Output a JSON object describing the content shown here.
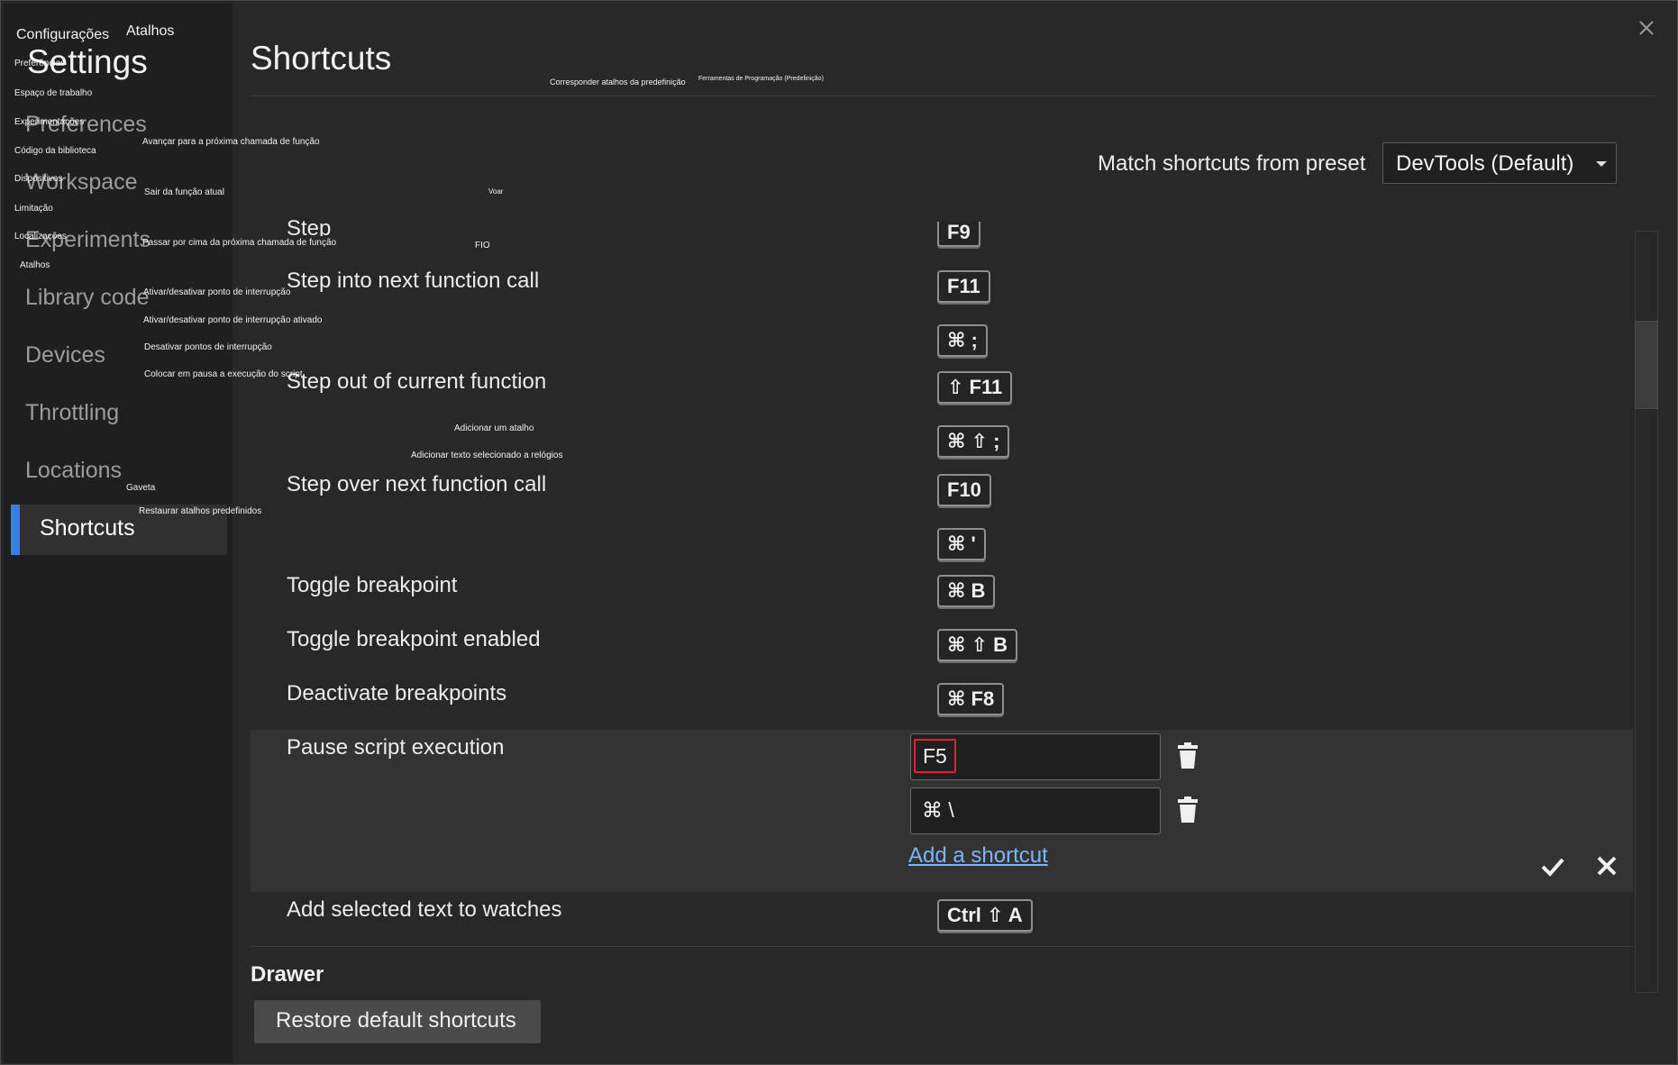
{
  "window": {
    "close_icon": "close-icon"
  },
  "sidebar": {
    "title": "Settings",
    "items": [
      {
        "id": "preferences",
        "label": "Preferences"
      },
      {
        "id": "workspace",
        "label": "Workspace"
      },
      {
        "id": "experiments",
        "label": "Experiments"
      },
      {
        "id": "library-code",
        "label": "Library code"
      },
      {
        "id": "devices",
        "label": "Devices"
      },
      {
        "id": "throttling",
        "label": "Throttling"
      },
      {
        "id": "locations",
        "label": "Locations"
      },
      {
        "id": "shortcuts",
        "label": "Shortcuts",
        "active": true
      }
    ],
    "accent_color": "#3a7ee0"
  },
  "main": {
    "title": "Shortcuts",
    "preset": {
      "label": "Match shortcuts from preset",
      "selected": "DevTools (Default)"
    },
    "shortcuts": [
      {
        "label": "Step",
        "keys": [
          "F9"
        ]
      },
      {
        "label": "Step into next function call",
        "keys": [
          "F11",
          "⌘ ;"
        ]
      },
      {
        "label": "Step out of current function",
        "keys": [
          "⇧ F11",
          "⌘ ⇧ ;"
        ]
      },
      {
        "label": "Step over next function call",
        "keys": [
          "F10",
          "⌘ '"
        ]
      },
      {
        "label": "Toggle breakpoint",
        "keys": [
          "⌘ B"
        ]
      },
      {
        "label": "Toggle breakpoint enabled",
        "keys": [
          "⌘ ⇧ B"
        ]
      },
      {
        "label": "Deactivate breakpoints",
        "keys": [
          "⌘ F8"
        ]
      }
    ],
    "editing": {
      "label": "Pause script execution",
      "inputs": [
        "F5",
        "⌘ \\"
      ],
      "add_link": "Add a shortcut",
      "confirm_icon": "checkmark-icon",
      "cancel_icon": "close-icon",
      "focus_color": "#e0213a"
    },
    "after_edit": {
      "label": "Add selected text to watches",
      "keys": [
        "Ctrl ⇧ A"
      ]
    },
    "drawer": {
      "title": "Drawer"
    },
    "restore_button": "Restore default shortcuts"
  },
  "translation_overlay": {
    "top": {
      "configuracoes": "Configurações",
      "atalhos": "Atalhos",
      "corresponder": "Corresponder atalhos da predefinição",
      "ferramentas": "Ferramentas de Programação (Predefinição)"
    },
    "sidebar": {
      "preferencias": "Preferências",
      "espaco": "Espaço de trabalho",
      "experimentacoes": "Experimentações",
      "codigo": "Código da biblioteca",
      "dispositivos": "Dispositivos",
      "limitacao": "Limitação",
      "localizacoes": "Localizações",
      "atalhos": "Atalhos"
    },
    "actions": {
      "avancar": "Avançar para a próxima chamada de função",
      "sair": "Sair da função atual",
      "voar": "Voar",
      "passar": "Passar por cima da próxima chamada de função",
      "fio": "FIO",
      "ativar": "Ativar/desativar ponto de interrupção",
      "ativar_ativado": "Ativar/desativar ponto de interrupção ativado",
      "desativar": "Desativar pontos de interrupção",
      "colocar": "Colocar em pausa a execução do script",
      "adicionar_atalho": "Adicionar um atalho",
      "adicionar_texto": "Adicionar texto selecionado a relógios",
      "gaveta": "Gaveta",
      "restaurar": "Restaurar atalhos predefinidos"
    }
  }
}
